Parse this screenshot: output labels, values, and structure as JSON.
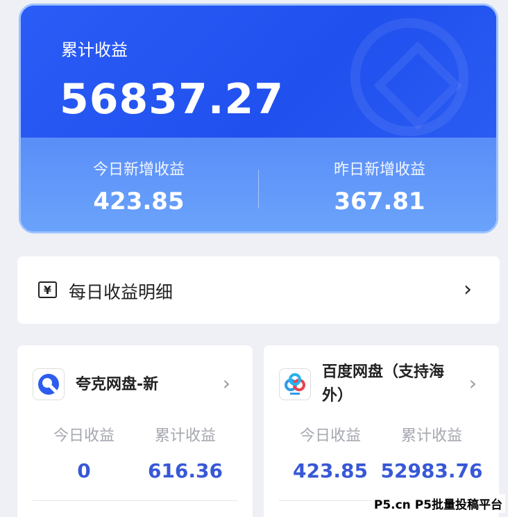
{
  "summary": {
    "total_label": "累计收益",
    "total_value": "56837.27",
    "today_label": "今日新增收益",
    "today_value": "423.85",
    "yesterday_label": "昨日新增收益",
    "yesterday_value": "367.81"
  },
  "detail_link": {
    "icon": "yen-icon",
    "label": "每日收益明细"
  },
  "apps": [
    {
      "name": "夸克网盘-新",
      "icon": "quark-icon",
      "today_label": "今日收益",
      "today_value": "0",
      "total_label": "累计收益",
      "total_value": "616.36"
    },
    {
      "name": "百度网盘（支持海外）",
      "icon": "baidu-netdisk-icon",
      "today_label": "今日收益",
      "today_value": "423.85",
      "total_label": "累计收益",
      "total_value": "52983.76"
    }
  ],
  "watermark": "P5.cn P5批量投稿平台",
  "colors": {
    "accent_blue": "#2b5cf6",
    "value_blue": "#3858d6"
  }
}
